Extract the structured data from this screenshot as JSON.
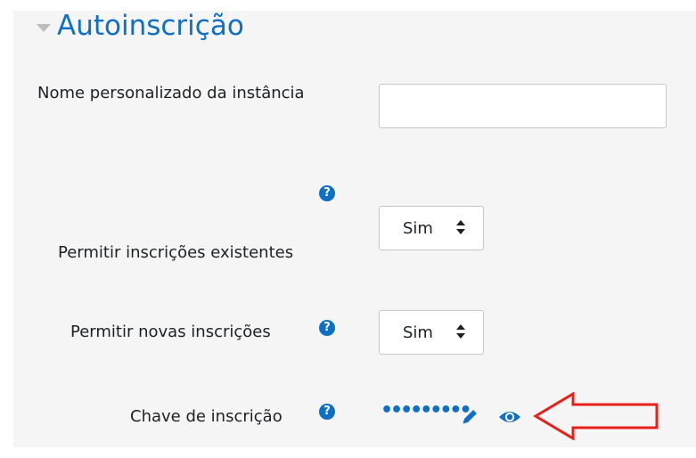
{
  "section": {
    "title": "Autoinscrição"
  },
  "fields": {
    "custom_name": {
      "label": "Nome personalizado da instância",
      "value": ""
    },
    "existing_enrolments": {
      "label": "Permitir inscrições existentes",
      "value": "Sim",
      "help": "?"
    },
    "new_enrolments": {
      "label": "Permitir novas inscrições",
      "value": "Sim",
      "help": "?"
    },
    "enrolment_key": {
      "label": "Chave de inscrição",
      "masked_value": "•••••••••",
      "help": "?"
    }
  },
  "icons": {
    "edit": "pencil-icon",
    "reveal": "eye-icon",
    "help": "question-circle-icon",
    "annotation": "red-arrow-icon"
  },
  "colors": {
    "accent": "#0f6fc5",
    "panel_background": "#f5f5f5",
    "annotation": "#e8201a"
  }
}
